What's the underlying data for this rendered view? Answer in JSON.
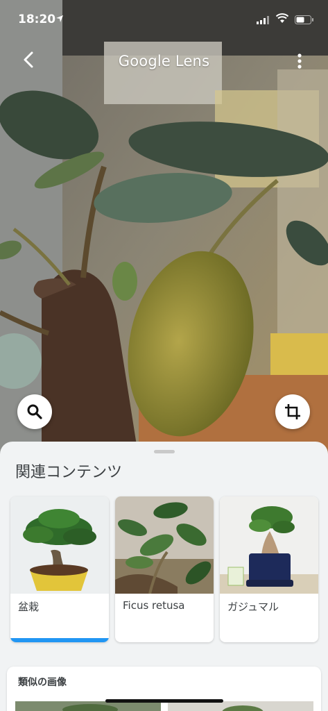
{
  "status_bar": {
    "time": "18:20",
    "location_icon": "location-arrow-icon",
    "signal_icon": "cellular-signal-icon",
    "wifi_icon": "wifi-icon",
    "battery_icon": "battery-icon"
  },
  "header": {
    "title": "Google Lens",
    "back_icon": "chevron-left-icon",
    "more_icon": "more-vertical-icon"
  },
  "actions": {
    "search_icon": "search-icon",
    "crop_icon": "crop-icon"
  },
  "results": {
    "section_title": "関連コンテンツ",
    "cards": [
      {
        "label": "盆栽",
        "selected": true
      },
      {
        "label": "Ficus retusa",
        "selected": false
      },
      {
        "label": "ガジュマル",
        "selected": false
      }
    ]
  },
  "similar": {
    "title": "類似の画像"
  },
  "colors": {
    "accent": "#2196f3",
    "sheet_bg": "#f1f3f4"
  }
}
